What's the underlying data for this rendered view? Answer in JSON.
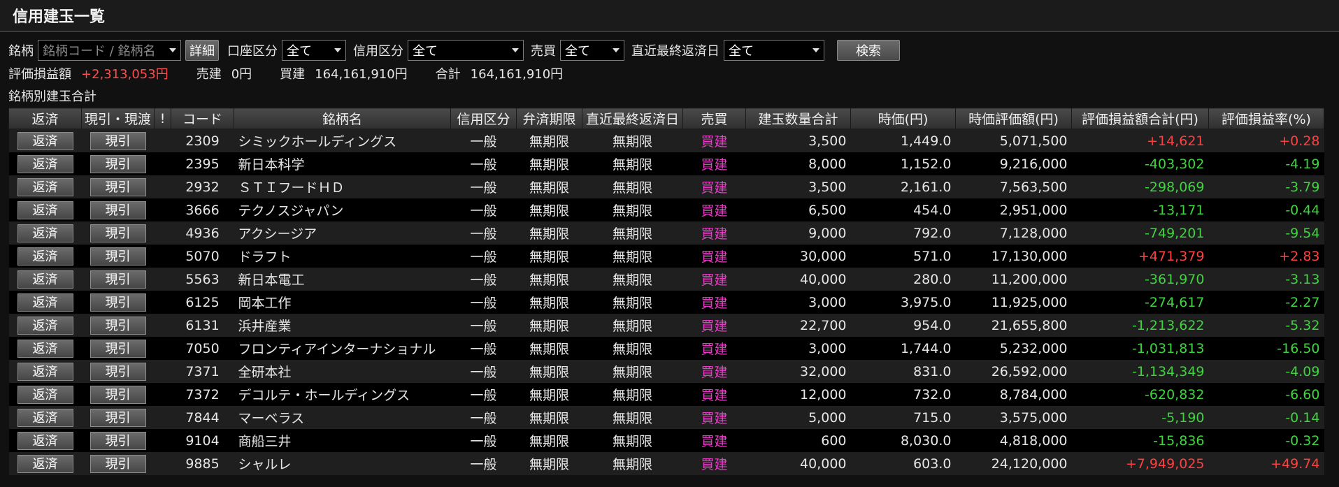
{
  "window": {
    "title": "信用建玉一覧"
  },
  "filters": {
    "stock_label": "銘柄",
    "stock_placeholder": "銘柄コード / 銘柄名",
    "detail_button": "詳細",
    "account_label": "口座区分",
    "account_value": "全て",
    "credit_label": "信用区分",
    "credit_value": "全て",
    "trade_label": "売買",
    "trade_value": "全て",
    "due_label": "直近最終返済日",
    "due_value": "全て",
    "search_button": "検索"
  },
  "summary": {
    "pl_label": "評価損益額",
    "pl_value": "+2,313,053円",
    "sell_label": "売建",
    "sell_value": "0円",
    "buy_label": "買建",
    "buy_value": "164,161,910円",
    "total_label": "合計",
    "total_value": "164,161,910円"
  },
  "section_title": "銘柄別建玉合計",
  "table": {
    "headers": [
      "返済",
      "現引・現渡",
      "!",
      "コード",
      "銘柄名",
      "信用区分",
      "弁済期限",
      "直近最終返済日",
      "売買",
      "建玉数量合計",
      "時価(円)",
      "時価評価額(円)",
      "評価損益額合計(円)",
      "評価損益率(%)"
    ],
    "repay_label": "返済",
    "delivery_label": "現引",
    "rows": [
      {
        "code": "2309",
        "name": "シミックホールディングス",
        "credit": "一般",
        "limit": "無期限",
        "due": "無期限",
        "side": "買建",
        "qty": "3,500",
        "price": "1,449.0",
        "value": "5,071,500",
        "pl": "+14,621",
        "rate": "+0.28",
        "sign": "pos"
      },
      {
        "code": "2395",
        "name": "新日本科学",
        "credit": "一般",
        "limit": "無期限",
        "due": "無期限",
        "side": "買建",
        "qty": "8,000",
        "price": "1,152.0",
        "value": "9,216,000",
        "pl": "-403,302",
        "rate": "-4.19",
        "sign": "neg"
      },
      {
        "code": "2932",
        "name": "ＳＴＩフードＨＤ",
        "credit": "一般",
        "limit": "無期限",
        "due": "無期限",
        "side": "買建",
        "qty": "3,500",
        "price": "2,161.0",
        "value": "7,563,500",
        "pl": "-298,069",
        "rate": "-3.79",
        "sign": "neg"
      },
      {
        "code": "3666",
        "name": "テクノスジャパン",
        "credit": "一般",
        "limit": "無期限",
        "due": "無期限",
        "side": "買建",
        "qty": "6,500",
        "price": "454.0",
        "value": "2,951,000",
        "pl": "-13,171",
        "rate": "-0.44",
        "sign": "neg"
      },
      {
        "code": "4936",
        "name": "アクシージア",
        "credit": "一般",
        "limit": "無期限",
        "due": "無期限",
        "side": "買建",
        "qty": "9,000",
        "price": "792.0",
        "value": "7,128,000",
        "pl": "-749,201",
        "rate": "-9.54",
        "sign": "neg"
      },
      {
        "code": "5070",
        "name": "ドラフト",
        "credit": "一般",
        "limit": "無期限",
        "due": "無期限",
        "side": "買建",
        "qty": "30,000",
        "price": "571.0",
        "value": "17,130,000",
        "pl": "+471,379",
        "rate": "+2.83",
        "sign": "pos"
      },
      {
        "code": "5563",
        "name": "新日本電工",
        "credit": "一般",
        "limit": "無期限",
        "due": "無期限",
        "side": "買建",
        "qty": "40,000",
        "price": "280.0",
        "value": "11,200,000",
        "pl": "-361,970",
        "rate": "-3.13",
        "sign": "neg"
      },
      {
        "code": "6125",
        "name": "岡本工作",
        "credit": "一般",
        "limit": "無期限",
        "due": "無期限",
        "side": "買建",
        "qty": "3,000",
        "price": "3,975.0",
        "value": "11,925,000",
        "pl": "-274,617",
        "rate": "-2.27",
        "sign": "neg"
      },
      {
        "code": "6131",
        "name": "浜井産業",
        "credit": "一般",
        "limit": "無期限",
        "due": "無期限",
        "side": "買建",
        "qty": "22,700",
        "price": "954.0",
        "value": "21,655,800",
        "pl": "-1,213,622",
        "rate": "-5.32",
        "sign": "neg"
      },
      {
        "code": "7050",
        "name": "フロンティアインターナショナル",
        "credit": "一般",
        "limit": "無期限",
        "due": "無期限",
        "side": "買建",
        "qty": "3,000",
        "price": "1,744.0",
        "value": "5,232,000",
        "pl": "-1,031,813",
        "rate": "-16.50",
        "sign": "neg"
      },
      {
        "code": "7371",
        "name": "全研本社",
        "credit": "一般",
        "limit": "無期限",
        "due": "無期限",
        "side": "買建",
        "qty": "32,000",
        "price": "831.0",
        "value": "26,592,000",
        "pl": "-1,134,349",
        "rate": "-4.09",
        "sign": "neg"
      },
      {
        "code": "7372",
        "name": "デコルテ・ホールディングス",
        "credit": "一般",
        "limit": "無期限",
        "due": "無期限",
        "side": "買建",
        "qty": "12,000",
        "price": "732.0",
        "value": "8,784,000",
        "pl": "-620,832",
        "rate": "-6.60",
        "sign": "neg"
      },
      {
        "code": "7844",
        "name": "マーベラス",
        "credit": "一般",
        "limit": "無期限",
        "due": "無期限",
        "side": "買建",
        "qty": "5,000",
        "price": "715.0",
        "value": "3,575,000",
        "pl": "-5,190",
        "rate": "-0.14",
        "sign": "neg"
      },
      {
        "code": "9104",
        "name": "商船三井",
        "credit": "一般",
        "limit": "無期限",
        "due": "無期限",
        "side": "買建",
        "qty": "600",
        "price": "8,030.0",
        "value": "4,818,000",
        "pl": "-15,836",
        "rate": "-0.32",
        "sign": "neg"
      },
      {
        "code": "9885",
        "name": "シャルレ",
        "credit": "一般",
        "limit": "無期限",
        "due": "無期限",
        "side": "買建",
        "qty": "40,000",
        "price": "603.0",
        "value": "24,120,000",
        "pl": "+7,949,025",
        "rate": "+49.74",
        "sign": "pos"
      }
    ]
  },
  "colors": {
    "positive": "#ff4040",
    "negative": "#3fd43f",
    "buy": "#e83cc8"
  }
}
